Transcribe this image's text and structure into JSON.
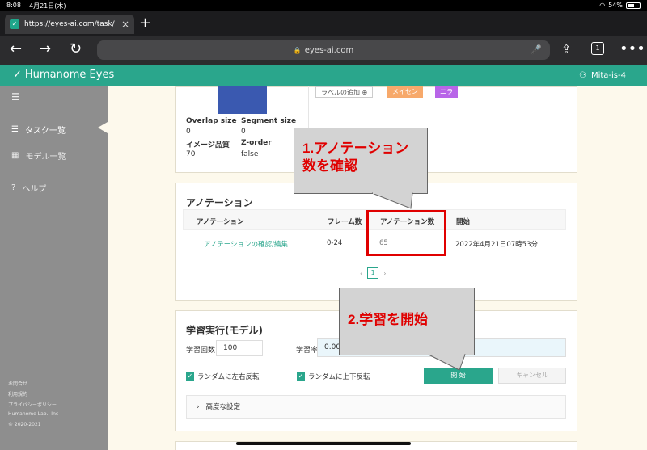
{
  "status": {
    "time": "8:08",
    "date": "4月21日(木)",
    "battery": "54%"
  },
  "browser": {
    "tab_title": "https://eyes-ai.com/task/",
    "url": "eyes-ai.com",
    "tab_count": "1"
  },
  "app": {
    "brand": "Humanome Eyes",
    "user": "Mita-is-4"
  },
  "sidebar": {
    "items": [
      {
        "label": "タスク一覧",
        "icon": "list-icon",
        "active": true
      },
      {
        "label": "モデル一覧",
        "icon": "chart-icon",
        "active": false
      },
      {
        "label": "ヘルプ",
        "icon": "help-icon",
        "active": false
      }
    ],
    "footer": [
      "お問合せ",
      "利用規約",
      "プライバシーポリシー",
      "Humanome Lab., Inc",
      "© 2020-2021"
    ]
  },
  "info": {
    "overlap_label": "Overlap size",
    "overlap_value": "0",
    "segment_label": "Segment size",
    "segment_value": "0",
    "quality_label": "イメージ品質",
    "quality_value": "70",
    "zorder_label": "Z-order",
    "zorder_value": "false",
    "add_label": "ラベルの追加",
    "tag1": "メイセン",
    "tag2": "ニラ"
  },
  "annotation": {
    "title": "アノテーション",
    "headers": [
      "アノテーション",
      "フレーム数",
      "アノテーション数",
      "開始"
    ],
    "row": {
      "link": "アノテーションの確認/編集",
      "frames": "0-24",
      "count": "65",
      "start": "2022年4月21日07時53分"
    },
    "page": "1"
  },
  "training": {
    "title": "学習実行(モデル)",
    "epochs_label": "学習回数",
    "epochs_value": "100",
    "lr_label": "学習率",
    "lr_value": "0.00",
    "flip_lr": "ランダムに左右反転",
    "flip_ud": "ランダムに上下反転",
    "start": "開 始",
    "cancel": "キャンセル",
    "advanced": "高度な設定"
  },
  "callouts": {
    "first": [
      "1.アノテーション",
      "数を確認"
    ],
    "second": "2.学習を開始"
  },
  "colors": {
    "accent": "#2aa68c",
    "callout_text": "#e00000"
  }
}
